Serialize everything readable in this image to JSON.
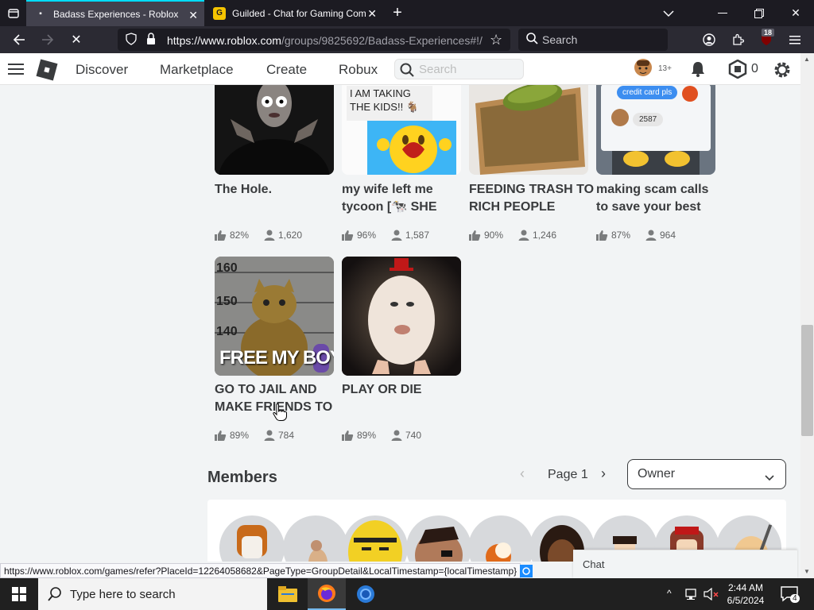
{
  "browser": {
    "tabs": [
      {
        "title": "Badass Experiences - Roblox",
        "active": true
      },
      {
        "title": "Guilded - Chat for Gaming Com",
        "active": false
      }
    ],
    "url_main": "https://www.roblox.com",
    "url_rest": "/groups/9825692/Badass-Experiences#!/",
    "search_placeholder": "Search",
    "notification_count": "18"
  },
  "roblox_header": {
    "nav": [
      "Discover",
      "Marketplace",
      "Create",
      "Robux"
    ],
    "search_placeholder": "Search",
    "age_badge": "13+",
    "robux_count": "0"
  },
  "games": [
    {
      "title_line1": "The Hole.",
      "title_line2": "",
      "rating": "82%",
      "players": "1,620",
      "thumb_text": ""
    },
    {
      "title_line1": "my wife left me",
      "title_line2": "tycoon [🐄 SHE",
      "rating": "96%",
      "players": "1,587",
      "thumb_text": "I AM TAKING THE KIDS!! 🐐"
    },
    {
      "title_line1": "FEEDING TRASH TO",
      "title_line2": "RICH PEOPLE",
      "rating": "90%",
      "players": "1,246",
      "thumb_text": ""
    },
    {
      "title_line1": "making scam calls",
      "title_line2": "to save your best",
      "rating": "87%",
      "players": "964",
      "thumb_text": "credit card pls",
      "thumb_text2": "2587"
    },
    {
      "title_line1": "GO TO JAIL AND",
      "title_line2": "MAKE FRIENDS TO",
      "rating": "89%",
      "players": "784",
      "thumb_text": "FREE MY BOY",
      "heights": [
        "160",
        "150",
        "140"
      ]
    },
    {
      "title_line1": "PLAY OR DIE",
      "title_line2": "",
      "rating": "89%",
      "players": "740",
      "thumb_text": ""
    }
  ],
  "members": {
    "title": "Members",
    "page_label": "Page 1",
    "role_selected": "Owner"
  },
  "status_url": "https://www.roblox.com/games/refer?PlaceId=12264058682&PageType=GroupDetail&LocalTimestamp={localTimestamp}",
  "chat_label": "Chat",
  "taskbar": {
    "search_placeholder": "Type here to search",
    "time": "2:44 AM",
    "date": "6/5/2024",
    "notification_count": "4"
  }
}
